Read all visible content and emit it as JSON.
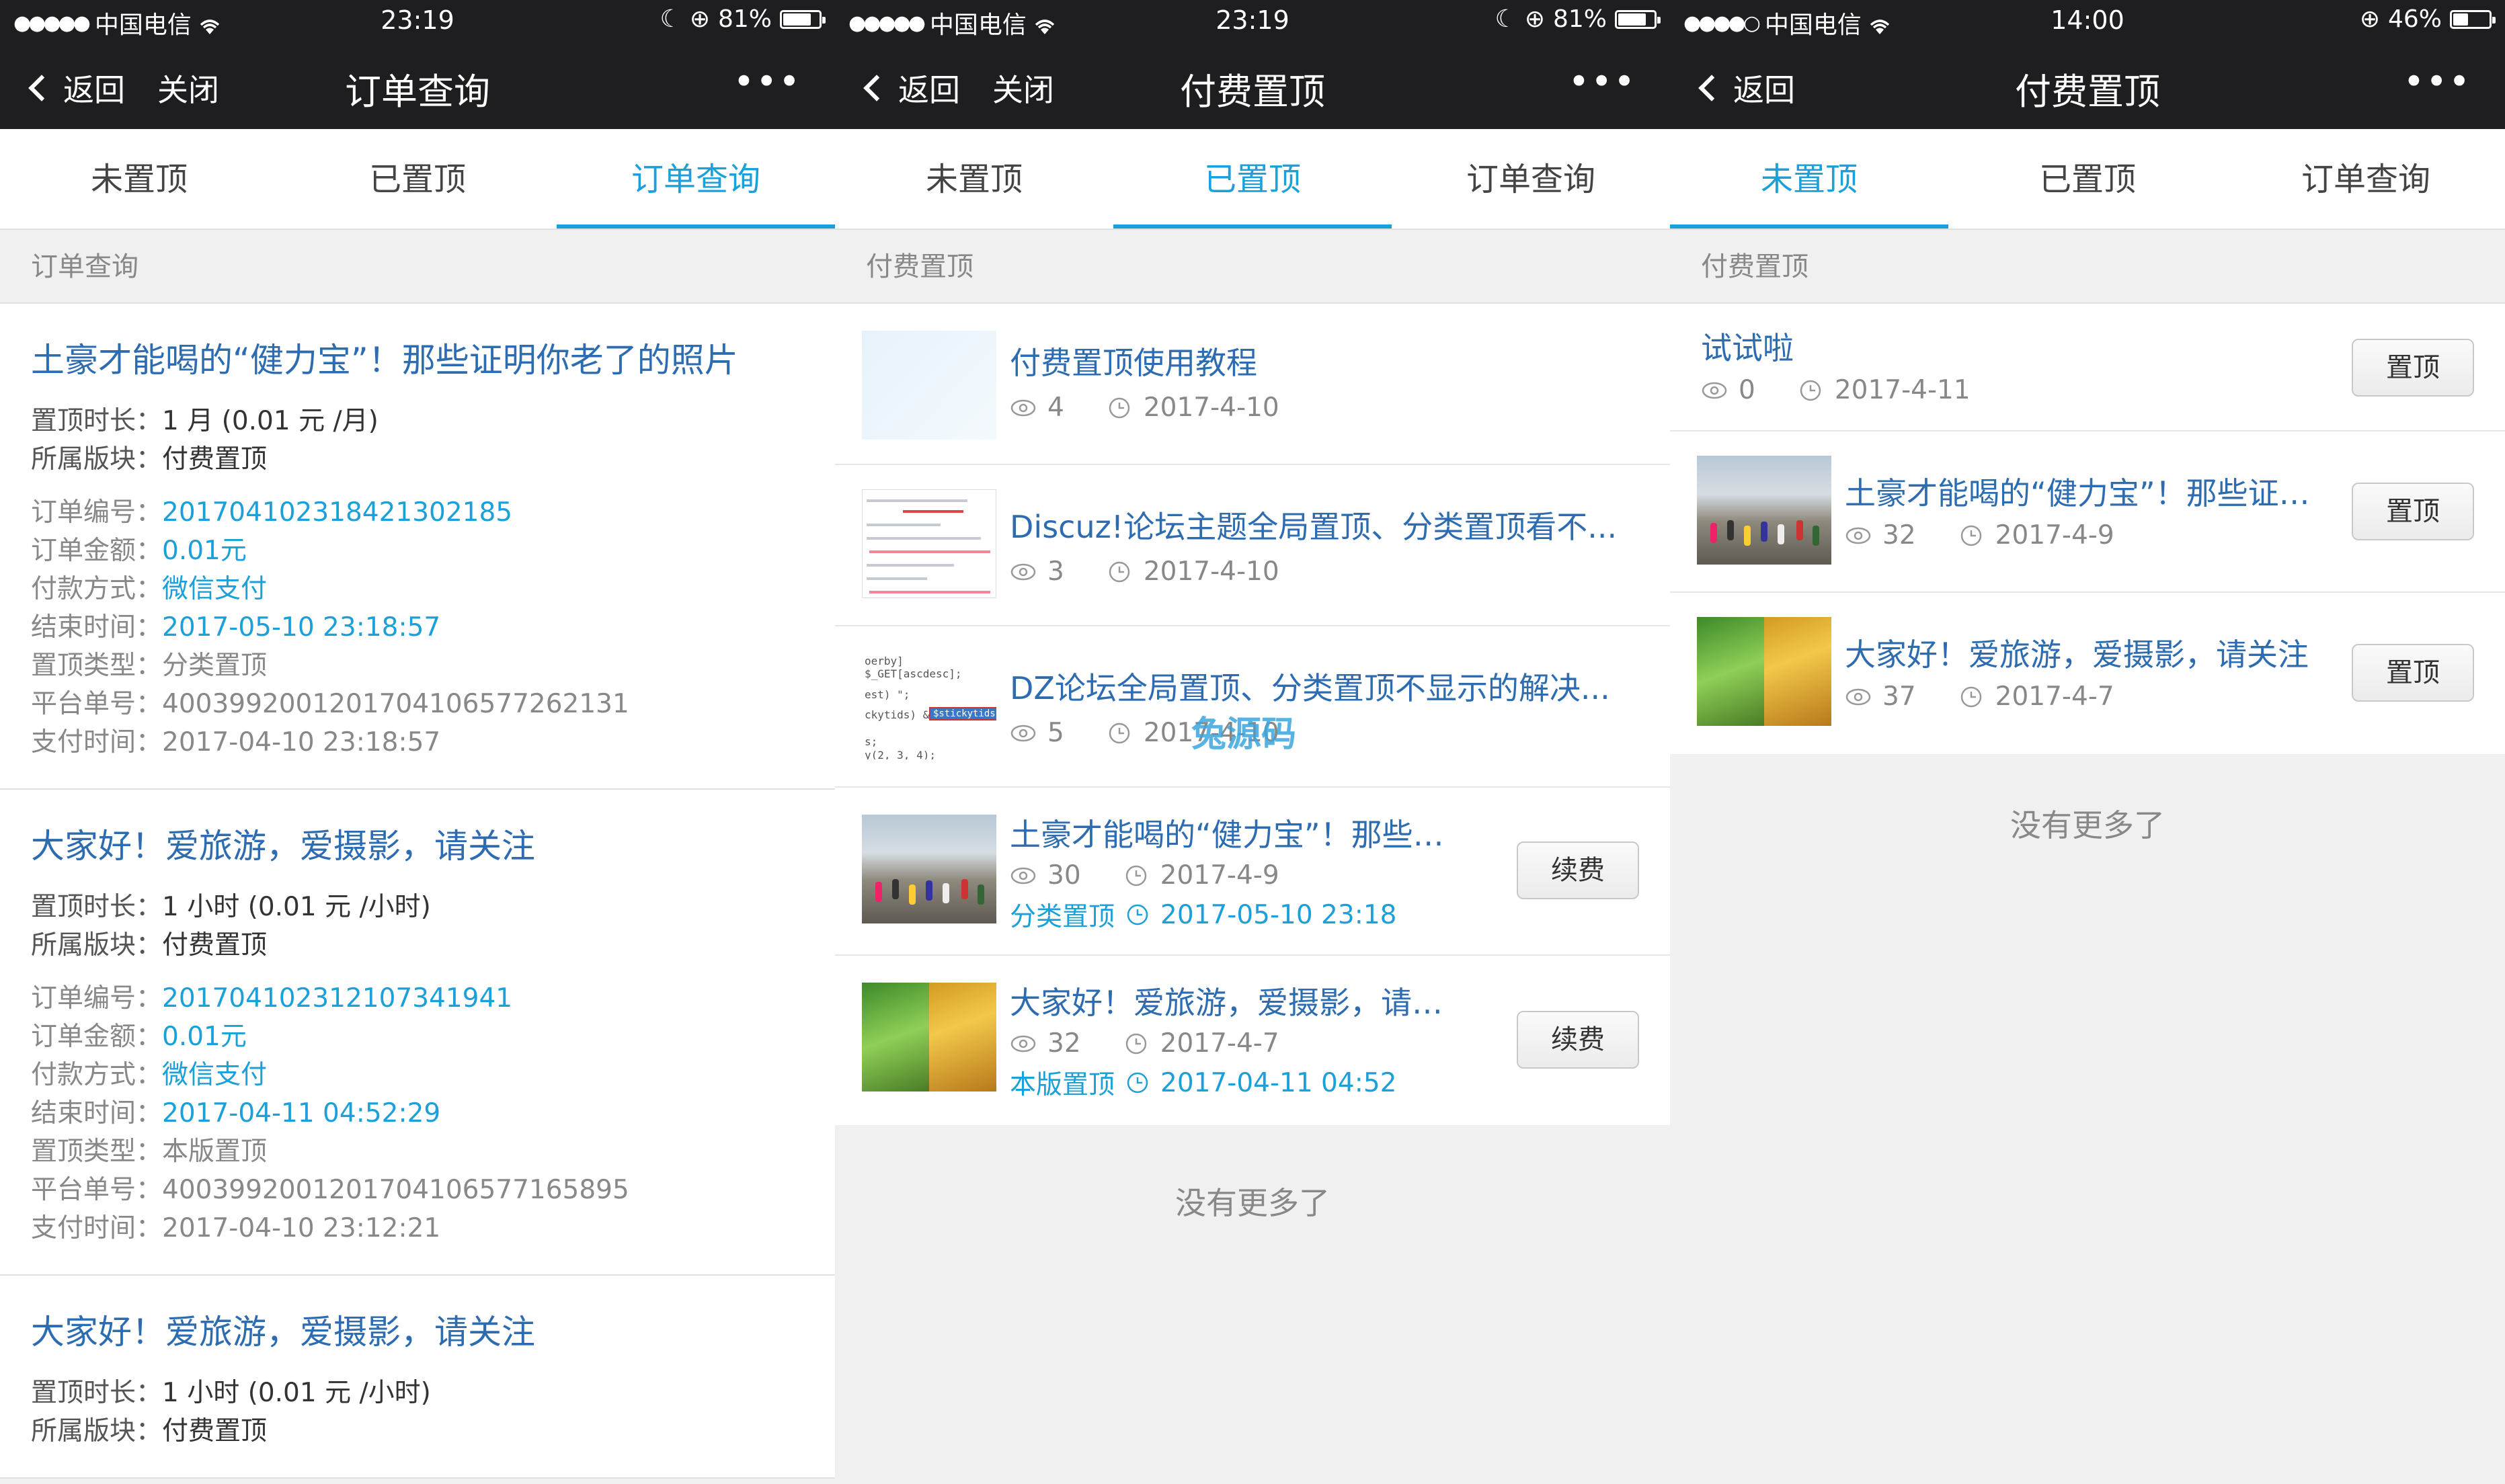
{
  "status_bars": [
    {
      "carrier": "中国电信",
      "signal": "●●●●●",
      "time": "23:19",
      "battery": "81%",
      "battery_level": 0.81
    },
    {
      "carrier": "中国电信",
      "signal": "●●●●●",
      "time": "23:19",
      "battery": "81%",
      "battery_level": 0.81
    },
    {
      "carrier": "中国电信",
      "signal": "●●●●○",
      "time": "14:00",
      "battery": "46%",
      "battery_level": 0.46
    }
  ],
  "navs": [
    {
      "back": "返回",
      "close": "关闭",
      "title": "订单查询",
      "more": "•••"
    },
    {
      "back": "返回",
      "close": "关闭",
      "title": "付费置顶",
      "more": "•••"
    },
    {
      "back": "返回",
      "title": "付费置顶",
      "more": "•••"
    }
  ],
  "tabs": [
    "未置顶",
    "已置顶",
    "订单查询"
  ],
  "active_tabs": [
    2,
    1,
    0
  ],
  "accent_color": "#1ba0d9",
  "panel1": {
    "section": "订单查询",
    "orders": [
      {
        "title": "土豪才能喝的“健力宝”！那些证明你老了的照片",
        "duration_label": "置顶时长：",
        "duration": "1 月 (0.01 元 /月)",
        "forum_label": "所属版块：",
        "forum": "付费置顶",
        "order_no_label": "订单编号：",
        "order_no": "201704102318421302185",
        "amount_label": "订单金额：",
        "amount": "0.01元",
        "pay_label": "付款方式：",
        "pay": "微信支付",
        "end_label": "结束时间：",
        "end": "2017-05-10 23:18:57",
        "type_label": "置顶类型：",
        "type": "分类置顶",
        "platform_label": "平台单号：",
        "platform": "4003992001201704106577262131",
        "paid_label": "支付时间：",
        "paid": "2017-04-10 23:18:57"
      },
      {
        "title": "大家好！爱旅游，爱摄影，请关注",
        "duration_label": "置顶时长：",
        "duration": "1 小时 (0.01 元 /小时)",
        "forum_label": "所属版块：",
        "forum": "付费置顶",
        "order_no_label": "订单编号：",
        "order_no": "201704102312107341941",
        "amount_label": "订单金额：",
        "amount": "0.01元",
        "pay_label": "付款方式：",
        "pay": "微信支付",
        "end_label": "结束时间：",
        "end": "2017-04-11 04:52:29",
        "type_label": "置顶类型：",
        "type": "本版置顶",
        "platform_label": "平台单号：",
        "platform": "4003992001201704106577165895",
        "paid_label": "支付时间：",
        "paid": "2017-04-10 23:12:21"
      },
      {
        "title": "大家好！爱旅游，爱摄影，请关注",
        "duration_label": "置顶时长：",
        "duration": "1 小时 (0.01 元 /小时)",
        "forum_label": "所属版块：",
        "forum": "付费置顶"
      }
    ]
  },
  "panel2": {
    "section": "付费置顶",
    "items": [
      {
        "title": "付费置顶使用教程",
        "views": "4",
        "date": "2017-4-10"
      },
      {
        "title": "Discuz!论坛主题全局置顶、分类置顶看不...",
        "views": "3",
        "date": "2017-4-10"
      },
      {
        "title": "DZ论坛全局置顶、分类置顶不显示的解决...",
        "views": "5",
        "date": "2017-4-10"
      },
      {
        "title": "土豪才能喝的“健力宝”！那些证明...",
        "views": "30",
        "date": "2017-4-9",
        "top_type": "分类置顶",
        "expire": "2017-05-10 23:18",
        "button": "续费"
      },
      {
        "title": "大家好！爱旅游，爱摄影，请关注",
        "views": "32",
        "date": "2017-4-7",
        "top_type": "本版置顶",
        "expire": "2017-04-11 04:52",
        "button": "续费"
      }
    ],
    "no_more": "没有更多了",
    "watermark": "兔源码"
  },
  "panel3": {
    "section": "付费置顶",
    "items": [
      {
        "title": "试试啦",
        "views": "0",
        "date": "2017-4-11",
        "button": "置顶"
      },
      {
        "title": "土豪才能喝的“健力宝”！那些证明...",
        "views": "32",
        "date": "2017-4-9",
        "button": "置顶"
      },
      {
        "title": "大家好！爱旅游，爱摄影，请关注",
        "views": "37",
        "date": "2017-4-7",
        "button": "置顶"
      }
    ],
    "no_more": "没有更多了"
  },
  "icons": {
    "views": "eye-icon",
    "date": "clock-icon",
    "back": "chevron-left-icon",
    "more": "more-dots-icon",
    "wifi": "wifi-icon",
    "battery": "battery-icon",
    "moon": "moon-icon",
    "lock": "rotation-lock-icon"
  }
}
